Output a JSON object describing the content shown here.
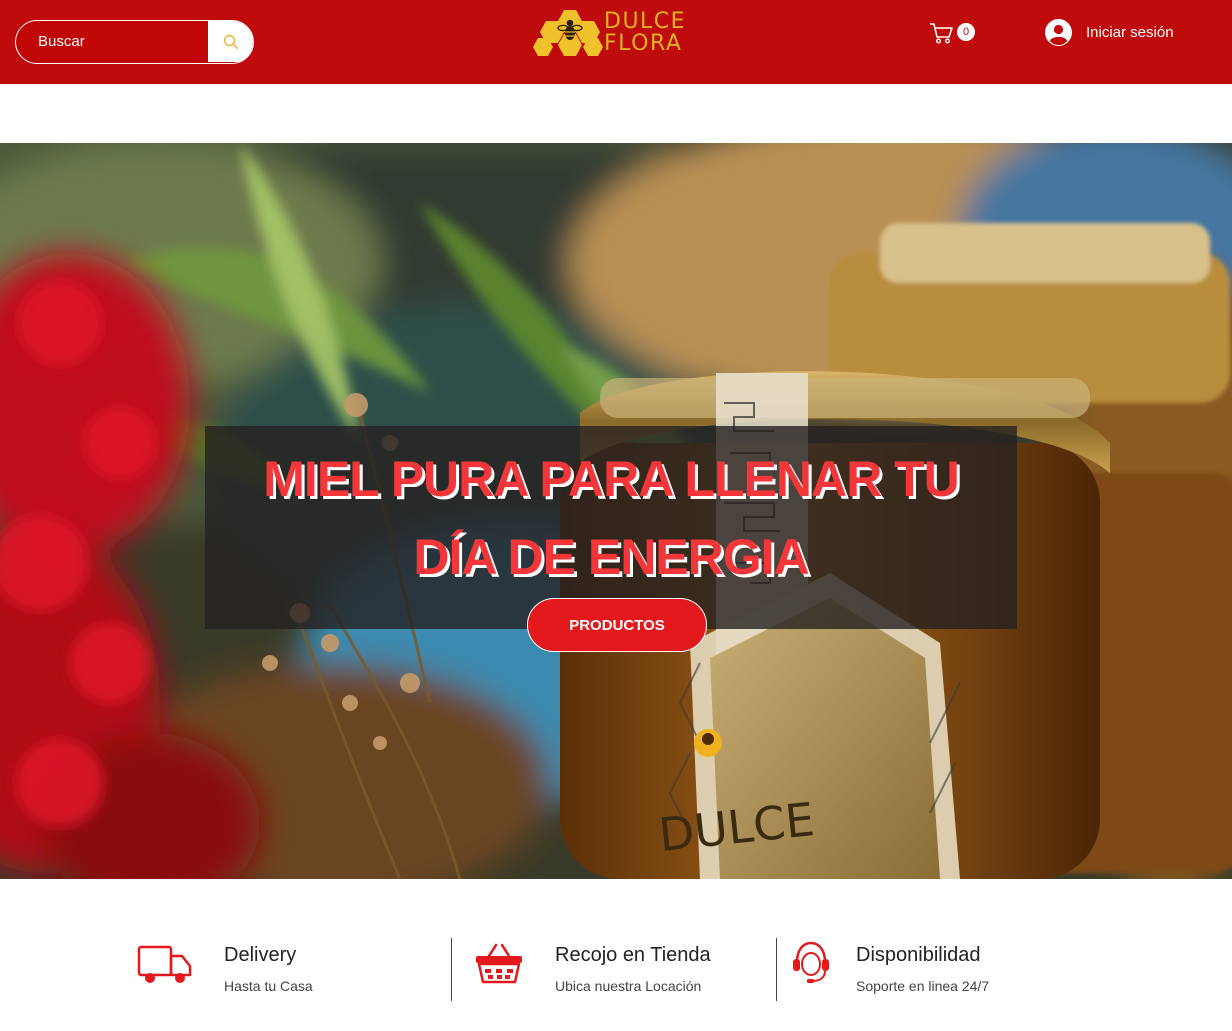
{
  "search": {
    "placeholder": "Buscar"
  },
  "brand": {
    "line1": "DULCE",
    "line2": "FLORA"
  },
  "cart": {
    "count": "0"
  },
  "login": {
    "label": "Iniciar sesión"
  },
  "hero": {
    "title_line1": "MIEL PURA PARA LLENAR TU",
    "title_line2": "DÍA DE ENERGIA",
    "cta": "PRODUCTOS",
    "jar_label": "DULCE"
  },
  "features": [
    {
      "icon": "delivery-truck-icon",
      "title": "Delivery",
      "subtitle": "Hasta tu Casa"
    },
    {
      "icon": "shopping-basket-icon",
      "title": "Recojo en Tienda",
      "subtitle": "Ubica nuestra Locación"
    },
    {
      "icon": "headset-support-icon",
      "title": "Disponibilidad",
      "subtitle": "Soporte en linea 24/7"
    }
  ],
  "colors": {
    "header": "#bf0b0b",
    "accent": "#e3191d",
    "title": "#f2363a",
    "gold": "#e2b31c"
  }
}
